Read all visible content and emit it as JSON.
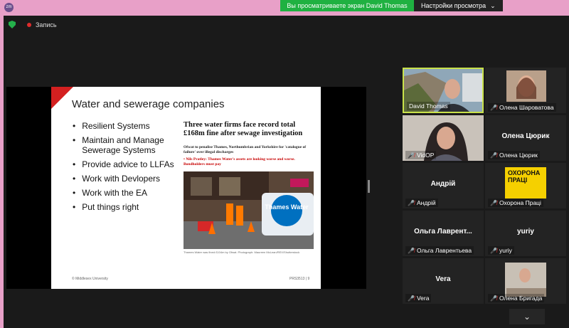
{
  "app": {
    "logo_text": "zm"
  },
  "banner": {
    "sharing_text": "Вы просматриваете экран David Thomas",
    "view_options_label": "Настройки просмотра",
    "view_options_arrow": "⌄"
  },
  "recording": {
    "label": "Запись"
  },
  "slide": {
    "title": "Water and sewerage companies",
    "bullets": [
      "Resilient Systems",
      "Maintain and Manage Sewerage Systems",
      "Provide advice to LLFAs",
      "Work with Devlopers",
      "Work with the EA",
      "Put things right"
    ],
    "article": {
      "headline": "Three water firms face record total £168m fine after sewage investigation",
      "standfirst": "Ofwat to penalise Thames, Northumbrian and Yorkshire for 'catalogue of failure' over illegal discharges",
      "related_marker": "•",
      "related_name": "Nils Pratley:",
      "related_text": "Thames Water's assets are looking worse and worse. Bondholders must pay",
      "photo_sign": "Thames Water",
      "caption": "Thames Water was fined £104m by Ofwat. Photograph: Maureen McLean/REX/Shutterstock"
    },
    "footer": "© Middlesex University",
    "page_number": "PRS3513 | 9"
  },
  "participants": [
    {
      "name": "David Thomas",
      "muted": false,
      "active": true,
      "has_video": true
    },
    {
      "name": "Олена Шароватова",
      "muted": true,
      "active": false,
      "has_video": true
    },
    {
      "name": "VidOP",
      "muted": true,
      "active": false,
      "has_video": true
    },
    {
      "name": "Олена Цюрик",
      "display_name": "Олена Цюрик",
      "muted": true,
      "active": false,
      "has_video": false
    },
    {
      "name": "Андрій",
      "display_name": "Андрій",
      "muted": true,
      "active": false,
      "has_video": false
    },
    {
      "name": "Охорона Праці",
      "muted": true,
      "active": false,
      "has_video": true,
      "poster_text": "ОХОРОНА ПРАЦІ"
    },
    {
      "name": "Ольга Лаврентьева",
      "display_name": "Ольга  Лаврент...",
      "muted": true,
      "active": false,
      "has_video": false
    },
    {
      "name": "yuriy",
      "display_name": "yuriy",
      "muted": true,
      "active": false,
      "has_video": false
    },
    {
      "name": "Vera",
      "display_name": "Vera",
      "muted": true,
      "active": false,
      "has_video": false
    },
    {
      "name": "Олена Бригада",
      "muted": true,
      "active": false,
      "has_video": true
    }
  ],
  "mic_icon_glyph": "🎤̸",
  "scroll": {
    "chevron_glyph": "⌄"
  },
  "colors": {
    "accent_green": "#1fb141",
    "active_border": "#c9e24a",
    "muted_red": "#e02c2c",
    "window_border": "#e8a0c8"
  }
}
